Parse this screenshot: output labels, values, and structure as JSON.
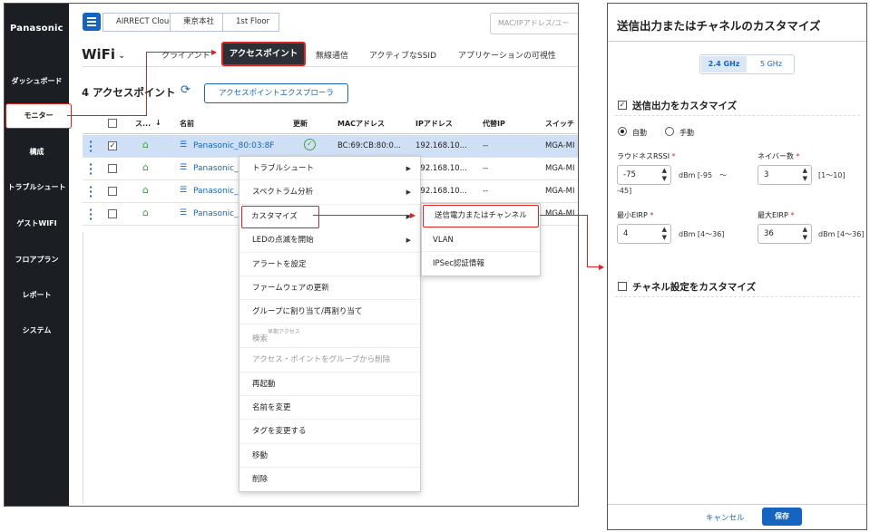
{
  "sidebar": {
    "logo": "Panasonic",
    "items": [
      {
        "label": "ダッシュボード"
      },
      {
        "label": "モニター"
      },
      {
        "label": "構成"
      },
      {
        "label": "トラブルシュート"
      },
      {
        "label": "ゲストWIFI"
      },
      {
        "label": "フロアプラン"
      },
      {
        "label": "レポート"
      },
      {
        "label": "システム"
      }
    ]
  },
  "breadcrumb": [
    "AIRRECT Cloud",
    "東京本社",
    "1st Floor"
  ],
  "search": {
    "placeholder": "MAC/IPアドレス/ユー"
  },
  "tabs": {
    "section": "WiFi",
    "items": [
      "クライアント",
      "アクセスポイント",
      "無線通信",
      "アクティブなSSID",
      "アプリケーションの可視性"
    ]
  },
  "heading": {
    "count_title": "4 アクセスポイント",
    "explorer_button": "アクセスポイントエクスプローラ"
  },
  "table": {
    "headers": [
      "ス...",
      "名前",
      "更新",
      "MACアドレス",
      "IPアドレス",
      "代替IP",
      "スイッチ"
    ],
    "rows": [
      {
        "name": "Panasonic_80:03:8F",
        "mac": "BC:69:CB:80:0...",
        "ip": "192.168.10...",
        "alt": "--",
        "switch": "MGA-MI",
        "checked": "✓"
      },
      {
        "name": "Panasonic_",
        "mac": "",
        "ip": "192.168.10...",
        "alt": "--",
        "switch": "MGA-MI",
        "checked": ""
      },
      {
        "name": "Panasonic_",
        "mac": "",
        "ip": "192.168.10...",
        "alt": "--",
        "switch": "MGA-MI",
        "checked": ""
      },
      {
        "name": "Panasonic_",
        "mac": "",
        "ip": "",
        "alt": "",
        "switch": "MGA-MI",
        "checked": ""
      }
    ]
  },
  "context_menu": {
    "items": [
      {
        "label": "トラブルシュート",
        "has_sub": true
      },
      {
        "label": "スペクトラム分析",
        "has_sub": true
      },
      {
        "label": "カスタマイズ",
        "has_sub": true
      },
      {
        "label": "LEDの点滅を開始",
        "has_sub": true
      },
      {
        "label": "アラートを設定"
      },
      {
        "label": "ファームウェアの更新"
      },
      {
        "label": "グループに割り当て/再割り当て"
      },
      {
        "label": "検索",
        "note": "早期アクセス",
        "disabled": true
      },
      {
        "label": "アクセス・ポイントをグループから削除",
        "disabled": true
      },
      {
        "label": "再起動"
      },
      {
        "label": "名前を変更"
      },
      {
        "label": "タグを変更する"
      },
      {
        "label": "移動"
      },
      {
        "label": "削除"
      }
    ],
    "submenu": [
      "送信電力またはチャンネル",
      "VLAN",
      "IPSec認証情報"
    ]
  },
  "panel": {
    "title": "送信出力またはチャネルのカスタマイズ",
    "bands": [
      "2.4 GHz",
      "5 GHz"
    ],
    "power_section": "送信出力をカスタマイズ",
    "mode_auto": "自動",
    "mode_manual": "手動",
    "rssi_label": "ラウドネスRSSI",
    "rssi_value": "-75",
    "rssi_unit": "dBm [-95　～",
    "rssi_unit2": "-45]",
    "neighbor_label": "ネイバー数",
    "neighbor_value": "3",
    "neighbor_unit": "[1～10]",
    "min_label": "最小EIRP",
    "min_value": "4",
    "min_unit": "dBm [4～36]",
    "max_label": "最大EIRP",
    "max_value": "36",
    "max_unit": "dBm [4～36]",
    "channel_section": "チャネル設定をカスタマイズ",
    "cancel": "キャンセル",
    "save": "保存",
    "required_mark": "*"
  }
}
